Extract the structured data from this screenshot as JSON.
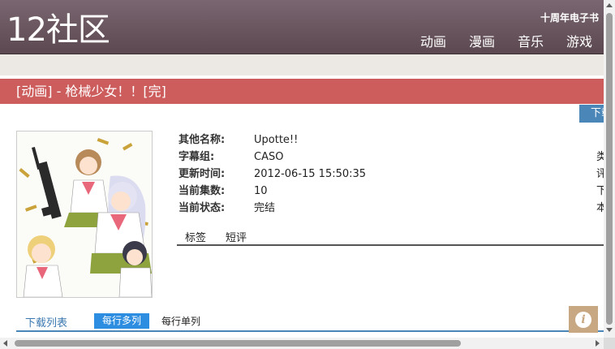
{
  "header": {
    "logo": "12社区",
    "ebook_link": "十周年电子书",
    "nav": [
      "动画",
      "漫画",
      "音乐",
      "游戏"
    ]
  },
  "page": {
    "title": "[动画] - 枪械少女！！[完]",
    "download_button": "下载"
  },
  "info": {
    "rows": [
      {
        "label": "其他名称:",
        "value": "Upotte!!"
      },
      {
        "label": "字幕组:",
        "value": "CASO"
      },
      {
        "label": "更新时间:",
        "value": "2012-06-15 15:50:35"
      },
      {
        "label": "当前集数:",
        "value": "10"
      },
      {
        "label": "当前状态:",
        "value": "完结"
      }
    ],
    "right_column_cut": [
      "类",
      "评",
      "下",
      "本"
    ]
  },
  "tabs": [
    "标签",
    "短评"
  ],
  "downloads": {
    "title": "下载列表",
    "multi_label": "每行多列",
    "single_label": "每行单列"
  },
  "info_button": "i",
  "colors": {
    "header": "#6b5660",
    "title_bar": "#cd5c5c",
    "accent_blue": "#2d8de0",
    "info_button": "#c8a882"
  }
}
